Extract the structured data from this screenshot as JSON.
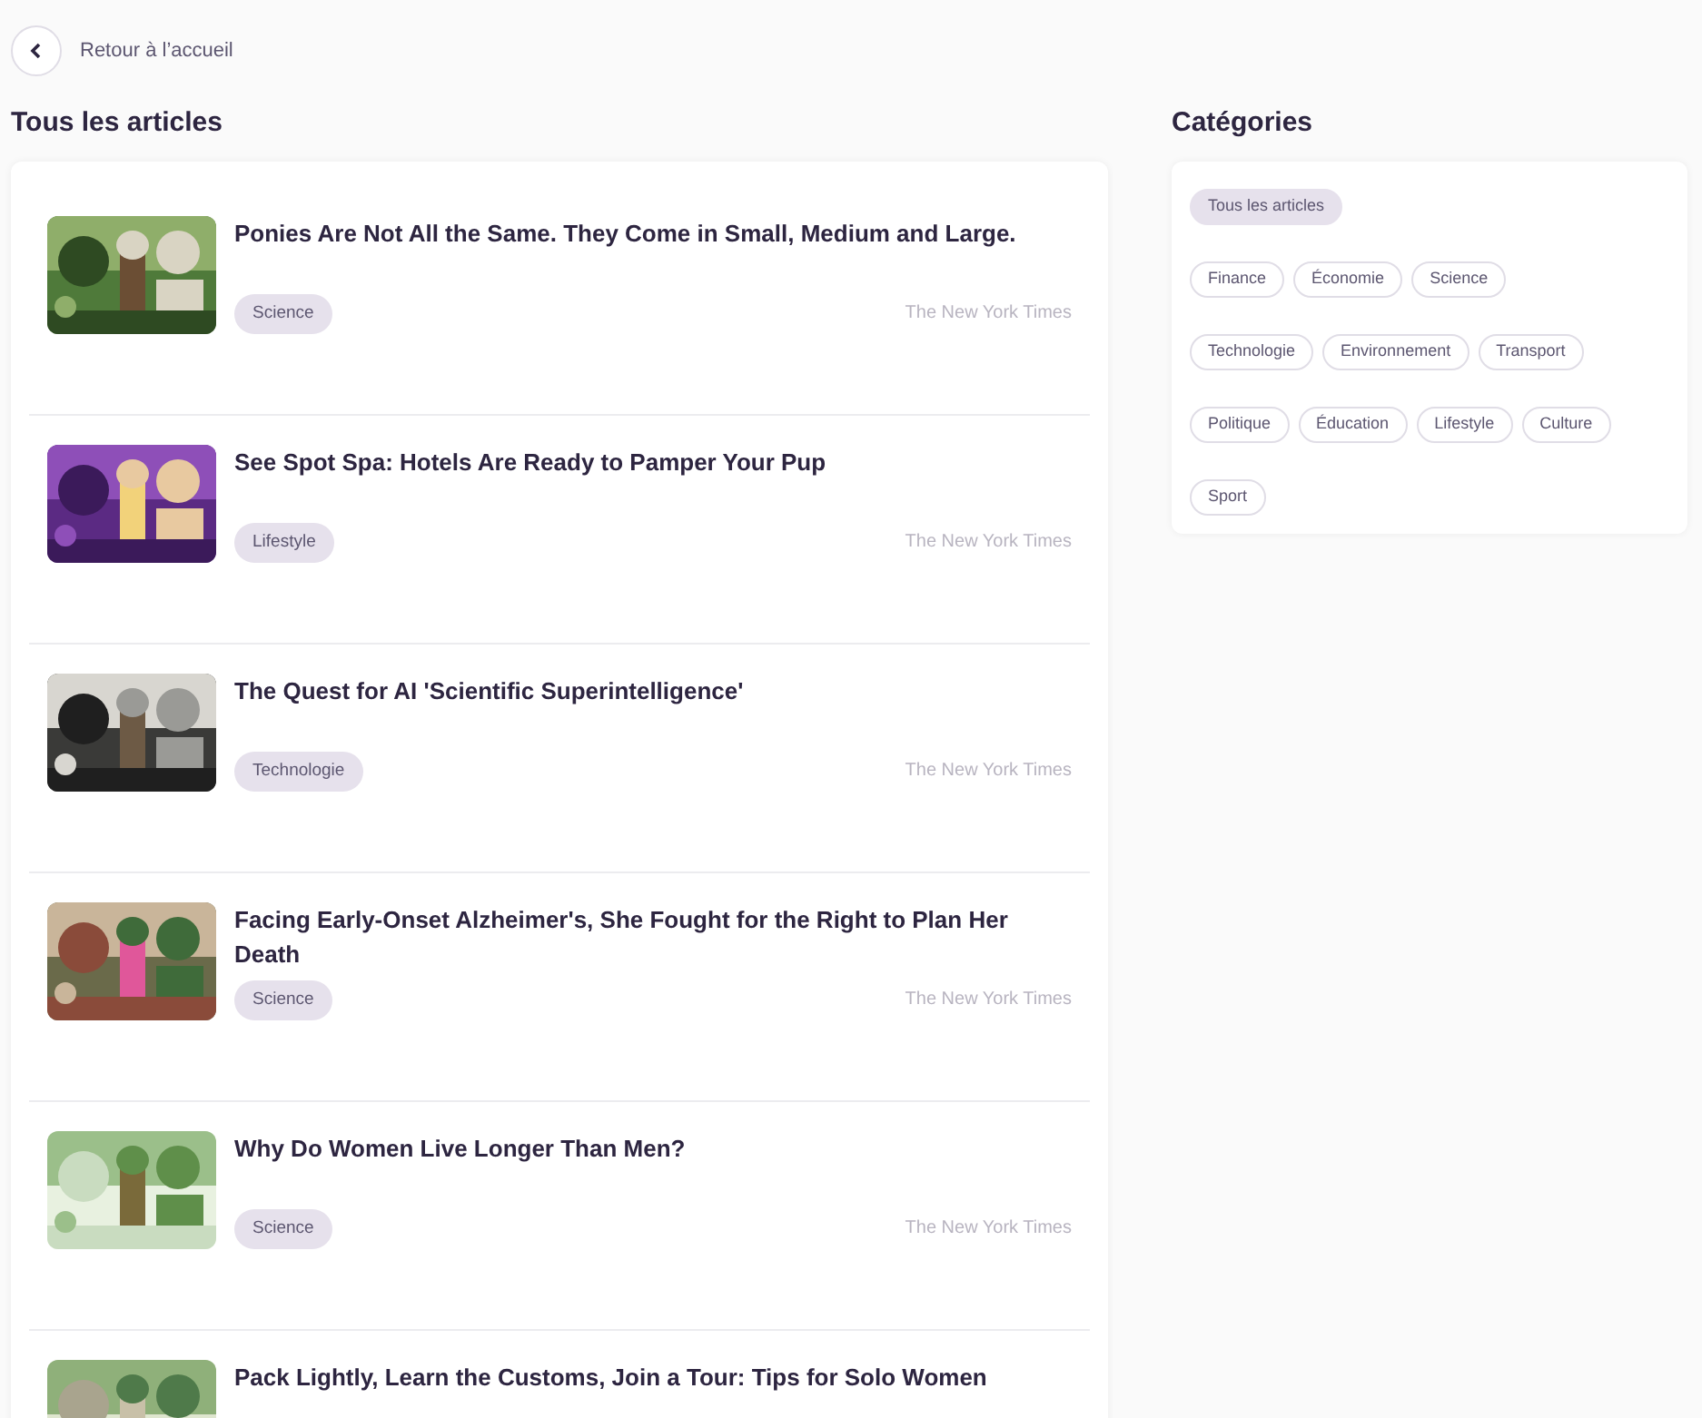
{
  "back_link": {
    "label": "Retour à l’accueil"
  },
  "articles_section": {
    "title": "Tous les articles",
    "articles": [
      {
        "title": "Ponies Are Not All the Same. They Come in Small, Medium and Large.",
        "category": "Science",
        "source": "The New York Times"
      },
      {
        "title": "See Spot Spa: Hotels Are Ready to Pamper Your Pup",
        "category": "Lifestyle",
        "source": "The New York Times"
      },
      {
        "title": "The Quest for AI 'Scientific Superintelligence'",
        "category": "Technologie",
        "source": "The New York Times"
      },
      {
        "title": "Facing Early-Onset Alzheimer's, She Fought for the Right to Plan Her Death",
        "category": "Science",
        "source": "The New York Times"
      },
      {
        "title": "Why Do Women Live Longer Than Men?",
        "category": "Science",
        "source": "The New York Times"
      },
      {
        "title": "Pack Lightly, Learn the Customs, Join a Tour: Tips for Solo Women"
      }
    ]
  },
  "categories_section": {
    "title": "Catégories",
    "categories": [
      {
        "label": "Tous les articles",
        "selected": true
      },
      {
        "label": "Finance",
        "selected": false
      },
      {
        "label": "Économie",
        "selected": false
      },
      {
        "label": "Science",
        "selected": false
      },
      {
        "label": "Technologie",
        "selected": false
      },
      {
        "label": "Environnement",
        "selected": false
      },
      {
        "label": "Transport",
        "selected": false
      },
      {
        "label": "Politique",
        "selected": false
      },
      {
        "label": "Éducation",
        "selected": false
      },
      {
        "label": "Lifestyle",
        "selected": false
      },
      {
        "label": "Culture",
        "selected": false
      },
      {
        "label": "Sport",
        "selected": false
      }
    ]
  }
}
